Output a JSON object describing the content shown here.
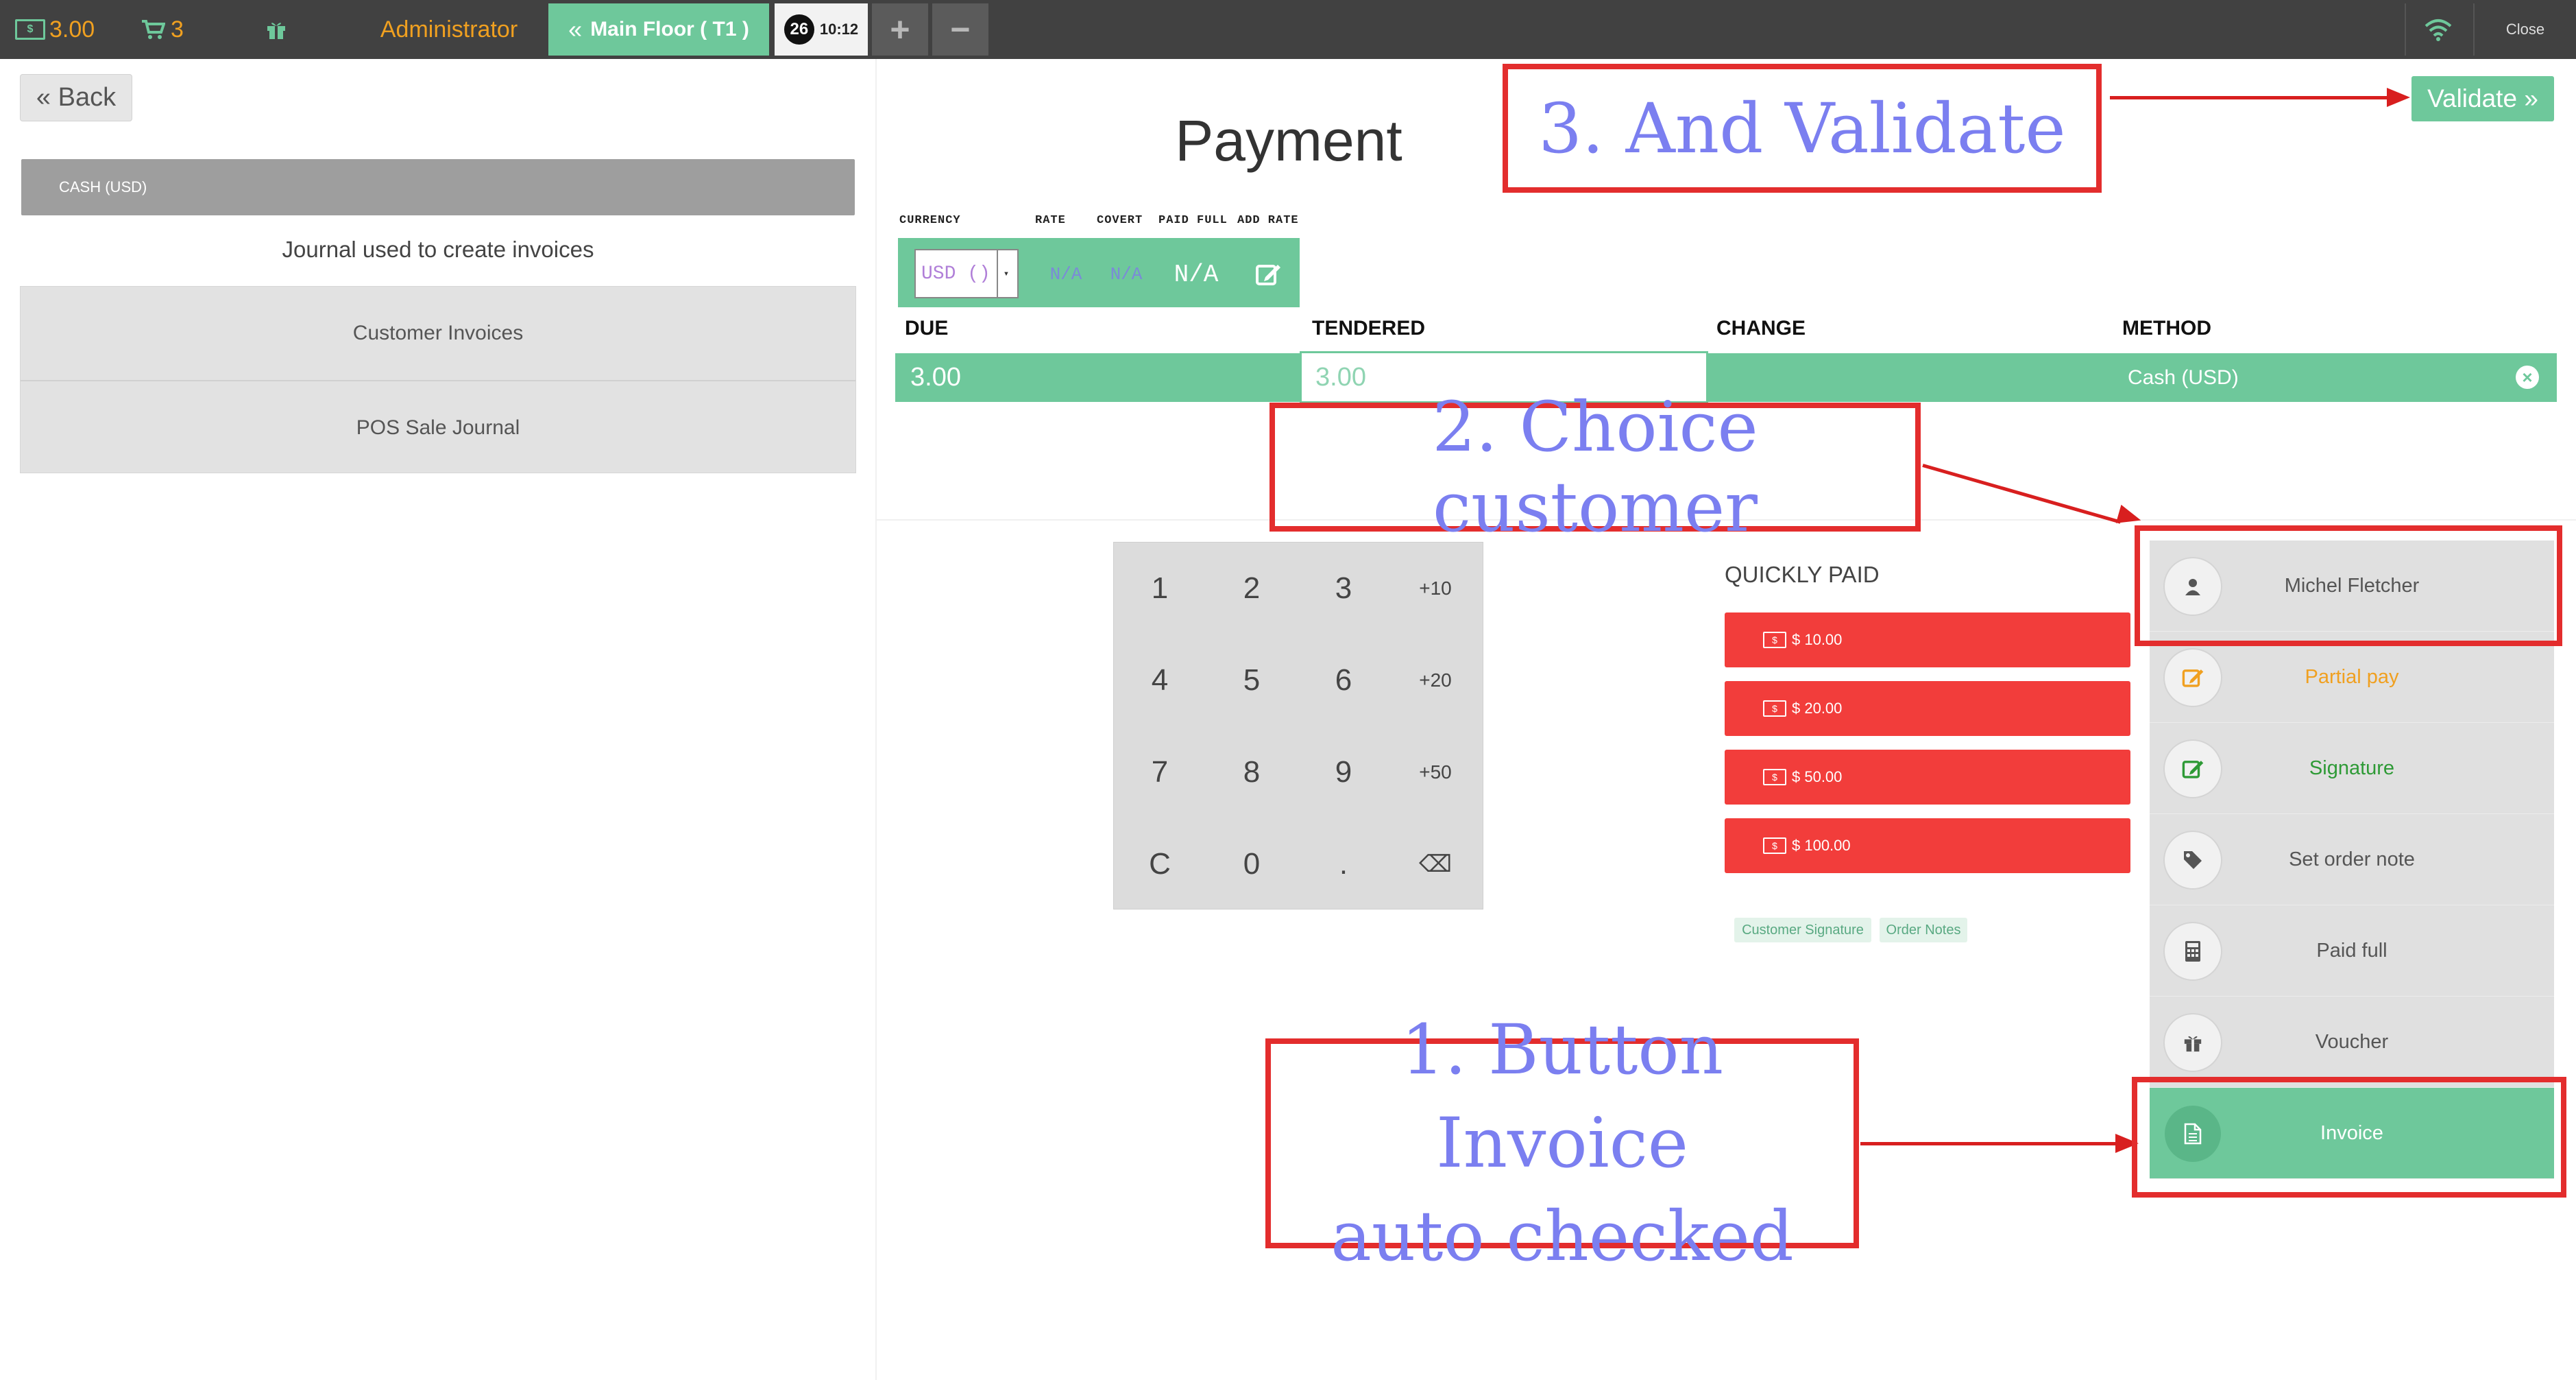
{
  "topbar": {
    "total": "3.00",
    "cart_count": "3",
    "user": "Administrator",
    "floor_button": "Main Floor ( T1 )",
    "order_count": "26",
    "order_time": "10:12",
    "close": "Close"
  },
  "left": {
    "back": "« Back",
    "journal_header": "CASH (USD)",
    "journal_label": "Journal used to create invoices",
    "journals": [
      "Customer Invoices",
      "POS Sale Journal"
    ]
  },
  "payment": {
    "title": "Payment",
    "currency_headers": [
      "CURRENCY",
      "RATE",
      "COVERT",
      "PAID FULL",
      "ADD RATE"
    ],
    "currency_select": "USD ()",
    "rate": "N/A",
    "covert": "N/A",
    "paid_full": "N/A",
    "line_headers": [
      "DUE",
      "TENDERED",
      "CHANGE",
      "METHOD"
    ],
    "line": {
      "due": "3.00",
      "tendered": "3.00",
      "method": "Cash (USD)"
    }
  },
  "numpad": {
    "keys": [
      "1",
      "2",
      "3",
      "+10",
      "4",
      "5",
      "6",
      "+20",
      "7",
      "8",
      "9",
      "+50",
      "C",
      "0",
      ".",
      "⌫"
    ]
  },
  "quickly_paid": {
    "title": "QUICKLY PAID",
    "amounts": [
      "$ 10.00",
      "$ 20.00",
      "$ 50.00",
      "$ 100.00"
    ],
    "tags": [
      "Customer Signature",
      "Order Notes"
    ]
  },
  "right_panel": {
    "items": [
      {
        "label": "Michel Fletcher",
        "icon": "user-icon",
        "color": "#555555"
      },
      {
        "label": "Partial pay",
        "icon": "edit-icon",
        "color": "#f0a020"
      },
      {
        "label": "Signature",
        "icon": "edit-icon",
        "color": "#2e9a36"
      },
      {
        "label": "Set order note",
        "icon": "tag-icon",
        "color": "#555555"
      },
      {
        "label": "Paid full",
        "icon": "calculator-icon",
        "color": "#555555"
      },
      {
        "label": "Voucher",
        "icon": "gift-icon",
        "color": "#555555"
      },
      {
        "label": "Invoice",
        "icon": "file-icon",
        "color": "#ffffff"
      }
    ],
    "validate": "Validate »"
  },
  "annotations": {
    "step3": "3. And Validate",
    "step2": "2. Choice customer",
    "step1_line1": "1. Button Invoice",
    "step1_line2": "auto checked"
  },
  "colors": {
    "accent": "#6ec89b",
    "danger": "#f23d3b",
    "topbar": "#414141",
    "annotation": "#7b7ff0",
    "annotation_box": "#e32d2d"
  }
}
